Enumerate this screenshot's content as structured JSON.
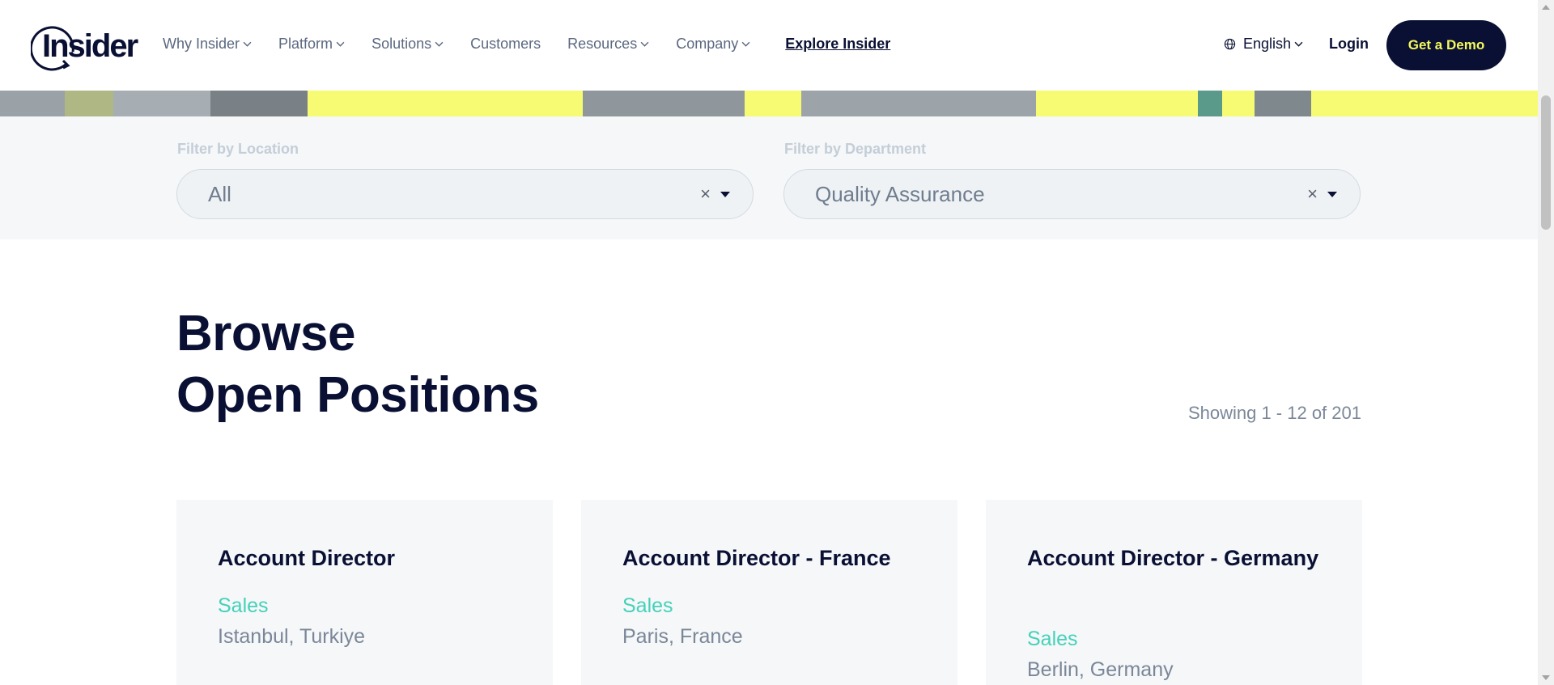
{
  "brand": {
    "logo_text": "Insider"
  },
  "nav": {
    "items": [
      {
        "label": "Why Insider",
        "has_dropdown": true
      },
      {
        "label": "Platform",
        "has_dropdown": true
      },
      {
        "label": "Solutions",
        "has_dropdown": true
      },
      {
        "label": "Customers",
        "has_dropdown": false
      },
      {
        "label": "Resources",
        "has_dropdown": true
      },
      {
        "label": "Company",
        "has_dropdown": true
      }
    ],
    "explore_label": "Explore Insider",
    "language_label": "English",
    "login_label": "Login",
    "demo_label": "Get a Demo"
  },
  "filters": {
    "location": {
      "label": "Filter by Location",
      "value": "All"
    },
    "department": {
      "label": "Filter by Department",
      "value": "Quality Assurance"
    },
    "clear_glyph": "×"
  },
  "main": {
    "title_line1": "Browse",
    "title_line2": "Open Positions",
    "showing": "Showing 1 - 12 of 201"
  },
  "jobs": [
    {
      "title": "Account Director",
      "department": "Sales",
      "location": "Istanbul, Turkiye"
    },
    {
      "title": "Account Director - France",
      "department": "Sales",
      "location": "Paris, France"
    },
    {
      "title": "Account Director - Germany",
      "department": "Sales",
      "location": "Berlin, Germany"
    }
  ],
  "colors": {
    "navy": "#0a1033",
    "accent_yellow": "#f4f95a",
    "department_teal": "#45d1b8",
    "muted_text": "#7b8798"
  }
}
